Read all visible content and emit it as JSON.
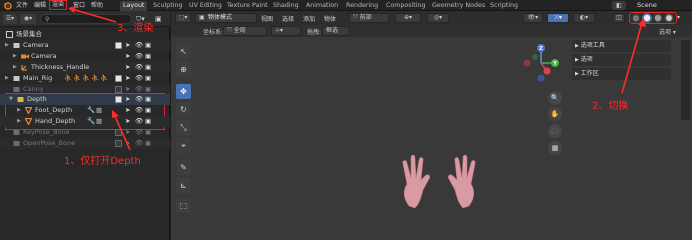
{
  "menu": {
    "file": "文件",
    "edit": "编辑",
    "render": "渲染",
    "window": "窗口",
    "help": "帮助"
  },
  "workspace_tabs": [
    "Layout",
    "Sculpting",
    "UV Editing",
    "Texture Paint",
    "Shading",
    "Animation",
    "Rendering",
    "Compositing",
    "Geometry Nodes",
    "Scripting"
  ],
  "scene": {
    "name": "Scene"
  },
  "outliner": {
    "collection": "场景集合",
    "rows": [
      {
        "label": "Camera",
        "dim": false
      },
      {
        "label": "Camera",
        "dim": false
      },
      {
        "label": "Thickness_Handle",
        "dim": false
      },
      {
        "label": "Main_Rig",
        "dim": false
      },
      {
        "label": "Canny",
        "dim": true
      },
      {
        "label": "Depth",
        "dim": false
      },
      {
        "label": "Foot_Depth",
        "dim": false
      },
      {
        "label": "Hand_Depth",
        "dim": false
      },
      {
        "label": "KeyPose_Bone",
        "dim": true
      },
      {
        "label": "OpenPose_Bone",
        "dim": true
      }
    ]
  },
  "viewport": {
    "mode": "物体模式",
    "menus": [
      "视图",
      "选择",
      "添加",
      "物体"
    ],
    "coord_label": "坐标系:",
    "coord_value": "全局",
    "pivot": "默认",
    "drag": "拖拽:",
    "drag_value": "框选",
    "snap": "前部",
    "options": "选项",
    "panels": [
      "选项工具",
      "选项",
      "工作区"
    ]
  },
  "annotations": {
    "step1": "1、仅打开Depth",
    "step2": "2、切换",
    "step3": "3、渲染"
  },
  "colors": {
    "accent_blue": "#4772b3",
    "annotation_red": "#ff2a2a",
    "hand_pink": "#d99aa4"
  }
}
